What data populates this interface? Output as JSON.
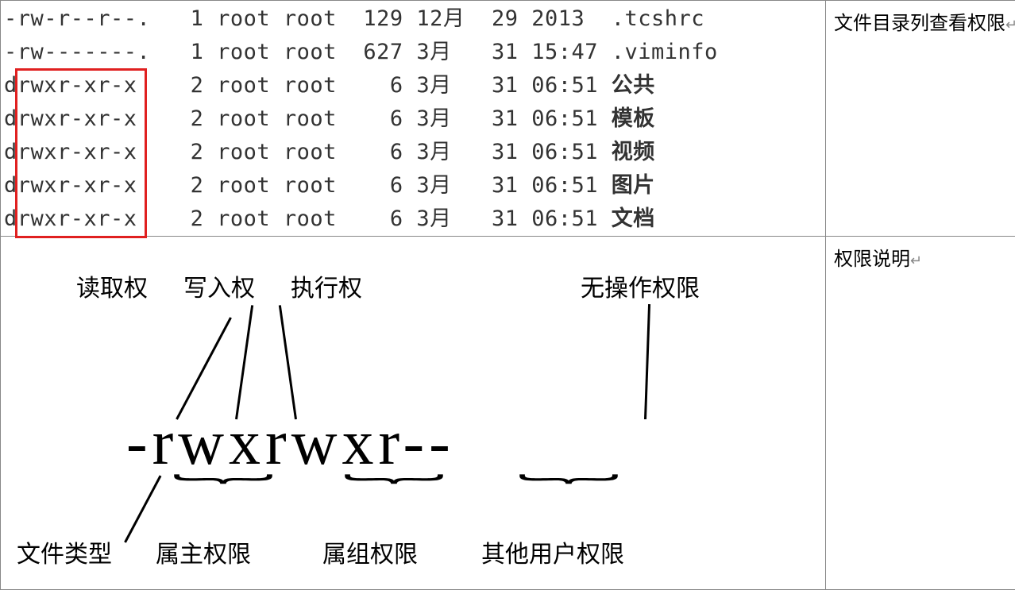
{
  "listing": {
    "rows": [
      {
        "perms": "-rw-r--r--.",
        "links": "1",
        "owner": "root",
        "group": "root",
        "size": "129",
        "month": "12月",
        "day": "29",
        "time": "2013",
        "name": ".tcshrc",
        "bold": false
      },
      {
        "perms": "-rw-------.",
        "links": "1",
        "owner": "root",
        "group": "root",
        "size": "627",
        "month": "3月",
        "day": "31",
        "time": "15:47",
        "name": ".viminfo",
        "bold": false
      },
      {
        "perms": "drwxr-xr-x",
        "links": "2",
        "owner": "root",
        "group": "root",
        "size": "6",
        "month": "3月",
        "day": "31",
        "time": "06:51",
        "name": "公共",
        "bold": true
      },
      {
        "perms": "drwxr-xr-x",
        "links": "2",
        "owner": "root",
        "group": "root",
        "size": "6",
        "month": "3月",
        "day": "31",
        "time": "06:51",
        "name": "模板",
        "bold": true
      },
      {
        "perms": "drwxr-xr-x",
        "links": "2",
        "owner": "root",
        "group": "root",
        "size": "6",
        "month": "3月",
        "day": "31",
        "time": "06:51",
        "name": "视频",
        "bold": true
      },
      {
        "perms": "drwxr-xr-x",
        "links": "2",
        "owner": "root",
        "group": "root",
        "size": "6",
        "month": "3月",
        "day": "31",
        "time": "06:51",
        "name": "图片",
        "bold": true
      },
      {
        "perms": "drwxr-xr-x",
        "links": "2",
        "owner": "root",
        "group": "root",
        "size": "6",
        "month": "3月",
        "day": "31",
        "time": "06:51",
        "name": "文档",
        "bold": true
      }
    ]
  },
  "right": {
    "cell1": "文件目录列查看权限",
    "cell2": "权限说明"
  },
  "diagram": {
    "perm_string": "-rwxrwxr--",
    "top_labels": {
      "read": "读取权",
      "write": "写入权",
      "exec": "执行权",
      "noop": "无操作权限"
    },
    "bottom_labels": {
      "ftype": "文件类型",
      "owner": "属主权限",
      "group": "属组权限",
      "other": "其他用户权限"
    }
  }
}
